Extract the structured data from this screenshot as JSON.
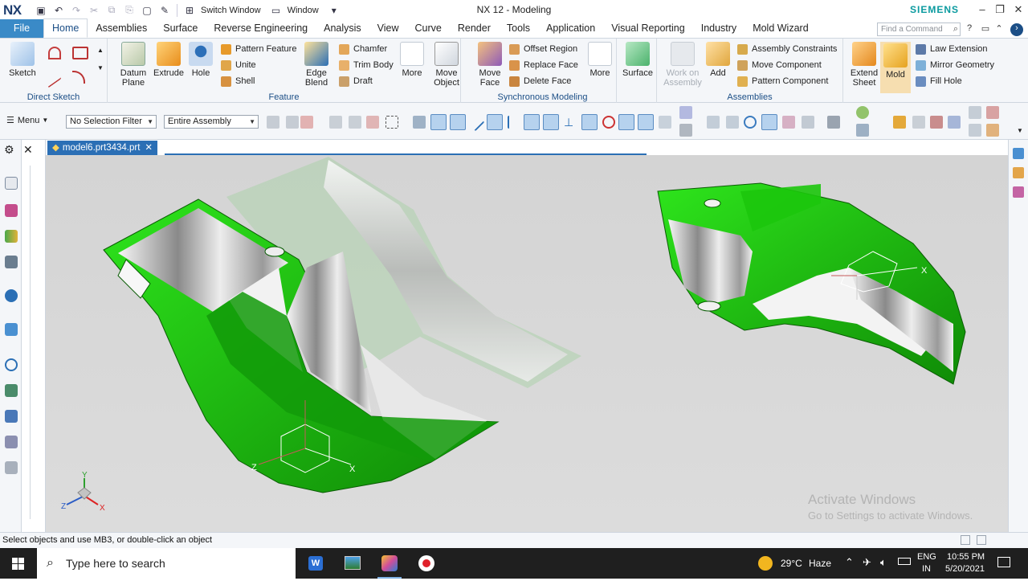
{
  "titlebar": {
    "logo": "NX",
    "switch_window": "Switch Window",
    "window_menu": "Window",
    "app_title": "NX 12 - Modeling",
    "brand": "SIEMENS"
  },
  "tabs": [
    {
      "label": "File"
    },
    {
      "label": "Home"
    },
    {
      "label": "Assemblies"
    },
    {
      "label": "Surface"
    },
    {
      "label": "Reverse Engineering"
    },
    {
      "label": "Analysis"
    },
    {
      "label": "View"
    },
    {
      "label": "Curve"
    },
    {
      "label": "Render"
    },
    {
      "label": "Tools"
    },
    {
      "label": "Application"
    },
    {
      "label": "Visual Reporting"
    },
    {
      "label": "Industry"
    },
    {
      "label": "Mold Wizard"
    }
  ],
  "command_search": {
    "placeholder": "Find a Command"
  },
  "ribbon": {
    "direct_sketch": {
      "label": "Direct Sketch",
      "sketch": "Sketch"
    },
    "feature": {
      "label": "Feature",
      "datum_plane": "Datum Plane",
      "extrude": "Extrude",
      "hole": "Hole",
      "pattern_feature": "Pattern Feature",
      "unite": "Unite",
      "shell": "Shell",
      "edge_blend": "Edge Blend",
      "chamfer": "Chamfer",
      "trim_body": "Trim Body",
      "draft": "Draft",
      "more": "More",
      "move_object": "Move Object"
    },
    "sync": {
      "label": "Synchronous Modeling",
      "move_face": "Move Face",
      "offset_region": "Offset Region",
      "replace_face": "Replace Face",
      "delete_face": "Delete Face",
      "more": "More"
    },
    "surface": "Surface",
    "assemblies": {
      "label": "Assemblies",
      "work_on_assembly": "Work on Assembly",
      "add": "Add",
      "assembly_constraints": "Assembly Constraints",
      "move_component": "Move Component",
      "pattern_component": "Pattern Component"
    },
    "extend_sheet": "Extend Sheet",
    "mold": "Mold",
    "law_extension": "Law Extension",
    "mirror_geometry": "Mirror Geometry",
    "fill_hole": "Fill Hole"
  },
  "selection_bar": {
    "menu": "Menu",
    "selection_filter": "No Selection Filter",
    "scope": "Entire Assembly"
  },
  "document": {
    "tab_label": "model6.prt3434.prt"
  },
  "viewport": {
    "watermark_title": "Activate Windows",
    "watermark_sub": "Go to Settings to activate Windows.",
    "axis_x": "X",
    "axis_y": "Y",
    "axis_z": "Z"
  },
  "status": {
    "message": "Select objects and use MB3, or double-click an object"
  },
  "taskbar": {
    "search_placeholder": "Type here to search",
    "weather_temp": "29°C",
    "weather_desc": "Haze",
    "lang": "ENG",
    "region": "IN",
    "time": "10:55 PM",
    "date": "5/20/2021"
  },
  "colors": {
    "part_green": "#1fb80f",
    "part_green_dark": "#117a08",
    "accent_blue": "#2b6fb5",
    "siemens_teal": "#0a9a9f"
  }
}
